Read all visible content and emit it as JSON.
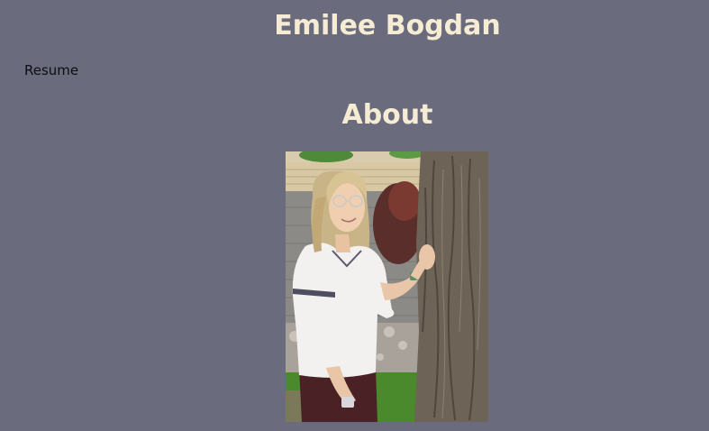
{
  "header": {
    "site_title": "Emilee Bogdan"
  },
  "nav": {
    "resume_label": "Resume"
  },
  "about": {
    "heading": "About",
    "photo_alt": "Emilee Bogdan"
  }
}
